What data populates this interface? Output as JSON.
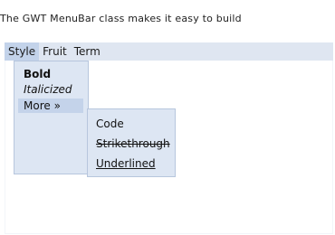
{
  "intro_text": "The GWT MenuBar class makes it easy to build",
  "menubar": {
    "items": [
      {
        "label": "Style"
      },
      {
        "label": "Fruit"
      },
      {
        "label": "Term"
      }
    ]
  },
  "style_menu": {
    "items": [
      {
        "label": "Bold"
      },
      {
        "label": "Italicized"
      },
      {
        "label": "More »"
      }
    ]
  },
  "more_submenu": {
    "items": [
      {
        "label": "Code"
      },
      {
        "label": "Strikethrough"
      },
      {
        "label": "Underlined"
      }
    ]
  }
}
